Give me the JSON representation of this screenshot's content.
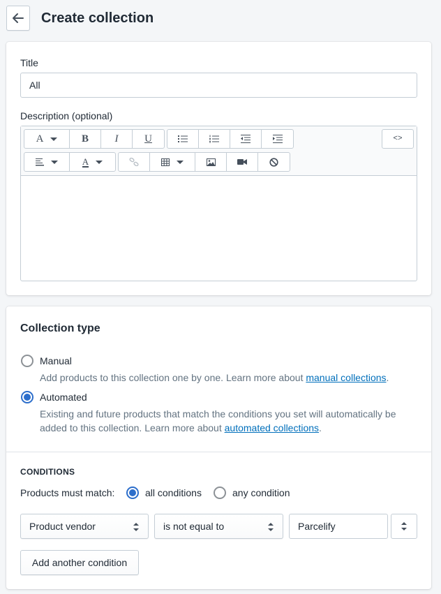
{
  "header": {
    "title": "Create collection"
  },
  "details": {
    "title_label": "Title",
    "title_value": "All",
    "description_label": "Description (optional)",
    "code_toggle": "<>"
  },
  "collection_type": {
    "heading": "Collection type",
    "manual": {
      "label": "Manual",
      "help_text": "Add products to this collection one by one. Learn more about ",
      "link": "manual collections",
      "help_suffix": ".",
      "selected": false
    },
    "automated": {
      "label": "Automated",
      "help_text": "Existing and future products that match the conditions you set will automatically be added to this collection. Learn more about ",
      "link": "automated collections",
      "help_suffix": ".",
      "selected": true
    }
  },
  "conditions": {
    "heading": "CONDITIONS",
    "match_label": "Products must match:",
    "all_label": "all conditions",
    "any_label": "any condition",
    "match_selected": "all",
    "rule": {
      "field": "Product vendor",
      "operator": "is not equal to",
      "value": "Parcelify"
    },
    "add_button": "Add another condition"
  },
  "colors": {
    "accent": "#2c6ecb",
    "link": "#006fbb",
    "border": "#c4cdd5",
    "background": "#f4f6f8"
  }
}
